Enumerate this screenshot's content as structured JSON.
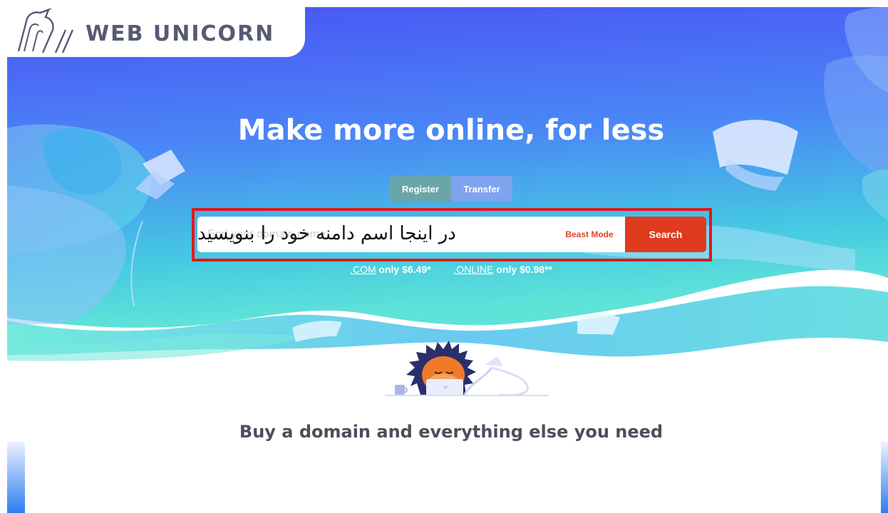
{
  "brand": {
    "logo_text": "WEB UNICORN",
    "logo_icon": "unicorn-head-icon"
  },
  "hero": {
    "headline": "Make more online, for less",
    "tabs": [
      {
        "label": "Register",
        "active": true
      },
      {
        "label": "Transfer",
        "active": false
      }
    ],
    "search": {
      "placeholder": "Find your domain name",
      "overlay_text": "در اینجا اسم دامنه خود را بنویسید",
      "beast_mode_label": "Beast Mode",
      "button_label": "Search"
    },
    "promos": [
      {
        "tld": ".COM",
        "rest": " only $6.49*"
      },
      {
        "tld": ".ONLINE",
        "rest": " only $0.98**"
      }
    ]
  },
  "section": {
    "subheading": "Buy a domain and everything else you need"
  },
  "colors": {
    "hero_top": "#4b5df5",
    "hero_bottom": "#3fd6d8",
    "search_button": "#df3b1f",
    "highlight_frame": "#e0181f",
    "tab_register": "#6aa6a9",
    "tab_transfer": "#7fa3ee"
  }
}
